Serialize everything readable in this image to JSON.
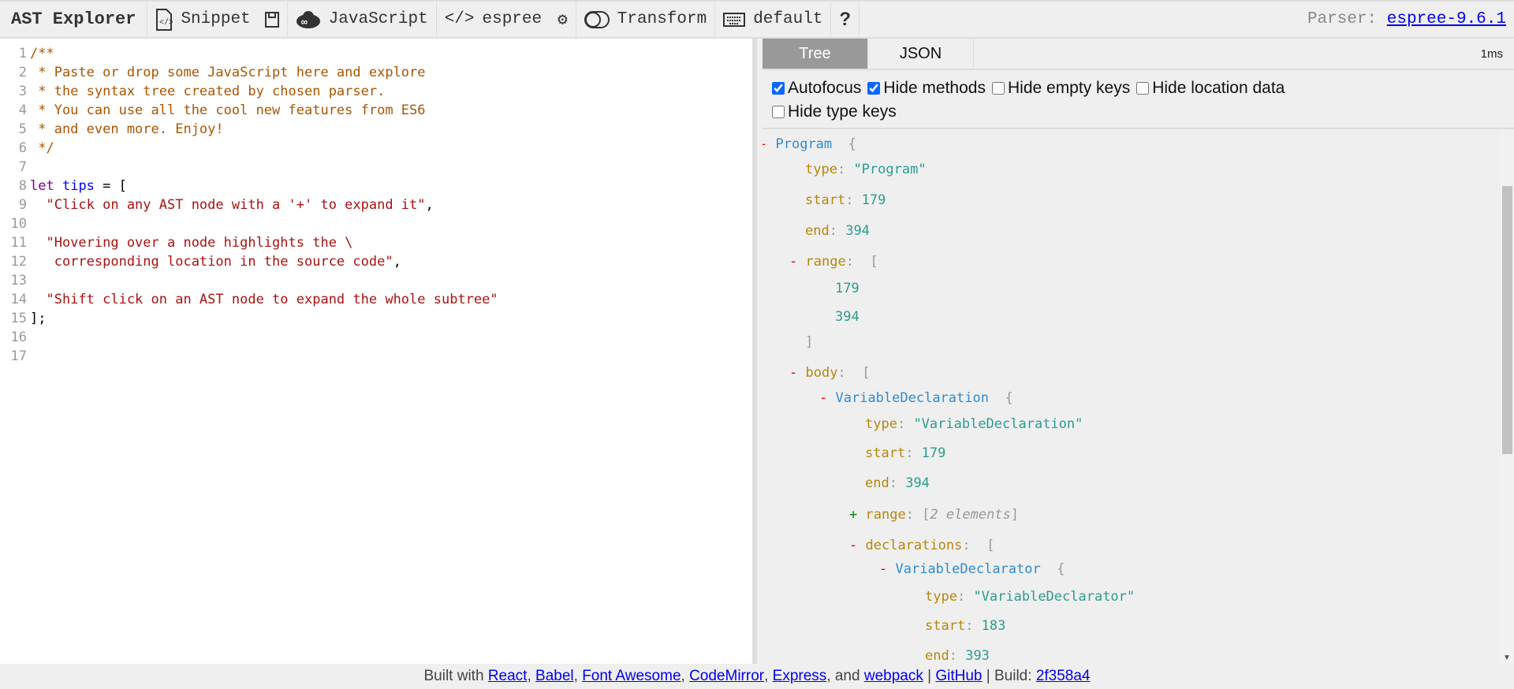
{
  "toolbar": {
    "title": "AST Explorer",
    "snippet": "Snippet",
    "language": "JavaScript",
    "parser_name": "espree",
    "transform": "Transform",
    "keymap": "default",
    "help": "?",
    "parser_label": "Parser:",
    "parser_version": "espree-9.6.1"
  },
  "editor": {
    "lines": [
      [
        [
          "comment",
          "/**"
        ]
      ],
      [
        [
          "comment",
          " * Paste or drop some JavaScript here and explore"
        ]
      ],
      [
        [
          "comment",
          " * the syntax tree created by chosen parser."
        ]
      ],
      [
        [
          "comment",
          " * You can use all the cool new features from ES6"
        ]
      ],
      [
        [
          "comment",
          " * and even more. Enjoy!"
        ]
      ],
      [
        [
          "comment",
          " */"
        ]
      ],
      [],
      [
        [
          "kw",
          "let"
        ],
        [
          "pl",
          " "
        ],
        [
          "def",
          "tips"
        ],
        [
          "pl",
          " = ["
        ]
      ],
      [
        [
          "str",
          "  \"Click on any AST node with a '+' to expand it\""
        ],
        [
          "pl",
          ","
        ]
      ],
      [],
      [
        [
          "str",
          "  \"Hovering over a node highlights the \\"
        ]
      ],
      [
        [
          "str",
          "   corresponding location in the source code\""
        ],
        [
          "pl",
          ","
        ]
      ],
      [],
      [
        [
          "str",
          "  \"Shift click on an AST node to expand the whole subtree\""
        ]
      ],
      [
        [
          "pl",
          "];"
        ]
      ],
      [],
      []
    ]
  },
  "output": {
    "tabs": [
      "Tree",
      "JSON"
    ],
    "active_tab": "Tree",
    "time": "1ms",
    "options": [
      {
        "label": "Autofocus",
        "checked": true
      },
      {
        "label": "Hide methods",
        "checked": true
      },
      {
        "label": "Hide empty keys",
        "checked": false
      },
      {
        "label": "Hide location data",
        "checked": false
      },
      {
        "label": "Hide type keys",
        "checked": false
      }
    ],
    "tree": [
      {
        "depth": 0,
        "toggle": "-",
        "node": "Program",
        "open": "{"
      },
      {
        "depth": 1,
        "key": "type",
        "str": "\"Program\""
      },
      {
        "depth": 1,
        "key": "start",
        "num": "179"
      },
      {
        "depth": 1,
        "key": "end",
        "num": "394"
      },
      {
        "depth": 1,
        "toggle": "-",
        "key": "range",
        "open": "["
      },
      {
        "depth": 2,
        "num": "179"
      },
      {
        "depth": 2,
        "num": "394"
      },
      {
        "depth": 1,
        "close": "]"
      },
      {
        "depth": 1,
        "toggle": "-",
        "key": "body",
        "open": "["
      },
      {
        "depth": 2,
        "toggle": "-",
        "node": "VariableDeclaration",
        "open": "{"
      },
      {
        "depth": 3,
        "key": "type",
        "str": "\"VariableDeclaration\""
      },
      {
        "depth": 3,
        "key": "start",
        "num": "179"
      },
      {
        "depth": 3,
        "key": "end",
        "num": "394"
      },
      {
        "depth": 3,
        "toggle": "+",
        "key": "range",
        "meta": "2 elements"
      },
      {
        "depth": 3,
        "toggle": "-",
        "key": "declarations",
        "open": "["
      },
      {
        "depth": 4,
        "toggle": "-",
        "node": "VariableDeclarator",
        "open": "{"
      },
      {
        "depth": 5,
        "key": "type",
        "str": "\"VariableDeclarator\""
      },
      {
        "depth": 5,
        "key": "start",
        "num": "183"
      },
      {
        "depth": 5,
        "key": "end",
        "num": "393"
      }
    ]
  },
  "footer": {
    "built_with": "Built with",
    "links": [
      "React",
      "Babel",
      "Font Awesome",
      "CodeMirror",
      "Express"
    ],
    "and": ", and",
    "webpack": "webpack",
    "github": "GitHub",
    "build_label": "Build:",
    "build": "2f358a4"
  }
}
